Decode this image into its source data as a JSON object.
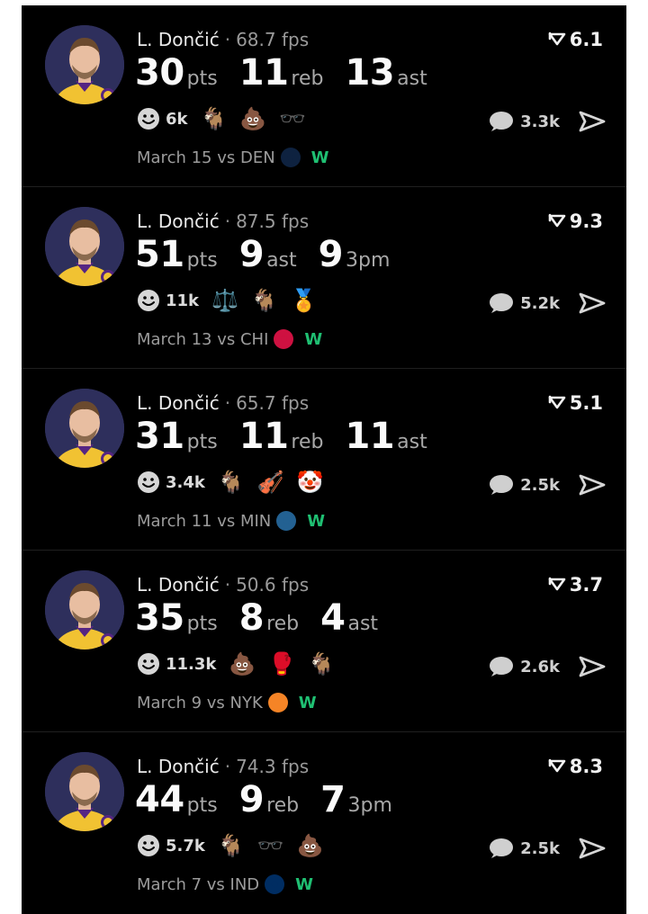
{
  "posts": [
    {
      "player": "L. Dončić",
      "fps": "68.7 fps",
      "score": "6.1",
      "stats": [
        {
          "value": "30",
          "unit": "pts"
        },
        {
          "value": "11",
          "unit": "reb"
        },
        {
          "value": "13",
          "unit": "ast"
        }
      ],
      "smile_count": "6k",
      "emojis": [
        "🐐",
        "💩",
        "🕶️"
      ],
      "comments": "3.3k",
      "date": "March 15 vs DEN",
      "team_logo_color": "#0e2240",
      "result": "W"
    },
    {
      "player": "L. Dončić",
      "fps": "87.5 fps",
      "score": "9.3",
      "stats": [
        {
          "value": "51",
          "unit": "pts"
        },
        {
          "value": "9",
          "unit": "ast"
        },
        {
          "value": "9",
          "unit": "3pm"
        }
      ],
      "smile_count": "11k",
      "emojis": [
        "⚖️",
        "🐐",
        "🏅"
      ],
      "comments": "5.2k",
      "date": "March 13 vs CHI",
      "team_logo_color": "#ce1141",
      "result": "W"
    },
    {
      "player": "L. Dončić",
      "fps": "65.7 fps",
      "score": "5.1",
      "stats": [
        {
          "value": "31",
          "unit": "pts"
        },
        {
          "value": "11",
          "unit": "reb"
        },
        {
          "value": "11",
          "unit": "ast"
        }
      ],
      "smile_count": "3.4k",
      "emojis": [
        "🐐",
        "🎻",
        "🤡"
      ],
      "comments": "2.5k",
      "date": "March 11 vs MIN",
      "team_logo_color": "#236192",
      "result": "W"
    },
    {
      "player": "L. Dončić",
      "fps": "50.6 fps",
      "score": "3.7",
      "stats": [
        {
          "value": "35",
          "unit": "pts"
        },
        {
          "value": "8",
          "unit": "reb"
        },
        {
          "value": "4",
          "unit": "ast"
        }
      ],
      "smile_count": "11.3k",
      "emojis": [
        "💩",
        "🥊",
        "🐐"
      ],
      "comments": "2.6k",
      "date": "March 9 vs NYK",
      "team_logo_color": "#f58426",
      "result": "W"
    },
    {
      "player": "L. Dončić",
      "fps": "74.3 fps",
      "score": "8.3",
      "stats": [
        {
          "value": "44",
          "unit": "pts"
        },
        {
          "value": "9",
          "unit": "reb"
        },
        {
          "value": "7",
          "unit": "3pm"
        }
      ],
      "smile_count": "5.7k",
      "emojis": [
        "🐐",
        "🕶️",
        "💩"
      ],
      "comments": "2.5k",
      "date": "March 7 vs IND",
      "team_logo_color": "#002d62",
      "result": "W"
    }
  ]
}
